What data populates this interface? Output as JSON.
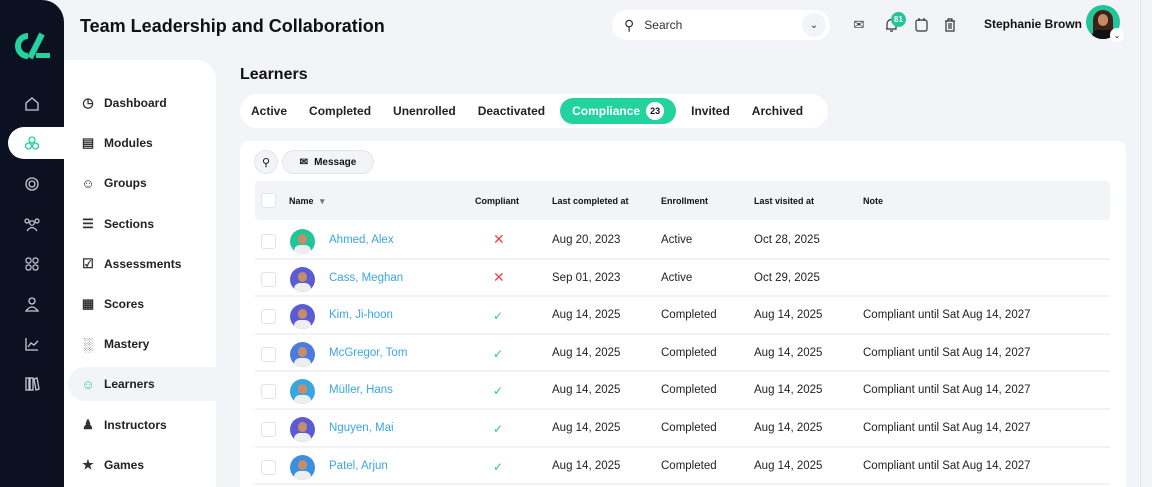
{
  "app": {
    "title": "Team Leadership and Collaboration"
  },
  "header": {
    "search_placeholder": "Search",
    "notification_count": "81",
    "user_name": "Stephanie Brown"
  },
  "rail": {
    "icons": [
      "home-icon",
      "modules-cubes-icon",
      "target-icon",
      "groups-icon",
      "apps-grid-icon",
      "user-icon",
      "chart-icon",
      "library-icon"
    ]
  },
  "sidebar": {
    "items": [
      {
        "label": "Dashboard",
        "icon": "dashboard-icon"
      },
      {
        "label": "Modules",
        "icon": "book-icon"
      },
      {
        "label": "Groups",
        "icon": "groups-icon"
      },
      {
        "label": "Sections",
        "icon": "list-icon"
      },
      {
        "label": "Assessments",
        "icon": "file-check-icon"
      },
      {
        "label": "Scores",
        "icon": "table-icon"
      },
      {
        "label": "Mastery",
        "icon": "bar-chart-icon"
      },
      {
        "label": "Learners",
        "icon": "user-icon",
        "active": true
      },
      {
        "label": "Instructors",
        "icon": "instructor-icon"
      },
      {
        "label": "Games",
        "icon": "trophy-icon"
      }
    ]
  },
  "main": {
    "heading": "Learners",
    "tabs": [
      {
        "label": "Active"
      },
      {
        "label": "Completed"
      },
      {
        "label": "Unenrolled"
      },
      {
        "label": "Deactivated"
      },
      {
        "label": "Compliance",
        "count": "23",
        "active": true
      },
      {
        "label": "Invited"
      },
      {
        "label": "Archived"
      }
    ],
    "toolbar": {
      "message_label": "Message"
    },
    "table": {
      "columns": [
        "Name",
        "Compliant",
        "Last completed at",
        "Enrollment",
        "Last visited at",
        "Note"
      ],
      "rows": [
        {
          "name": "Ahmed, Alex",
          "compliant": false,
          "last_completed": "Aug 20, 2023",
          "enrollment": "Active",
          "last_visited": "Oct 28, 2025",
          "note": "",
          "avatar_color": "#22c59a"
        },
        {
          "name": "Cass, Meghan",
          "compliant": false,
          "last_completed": "Sep 01, 2023",
          "enrollment": "Active",
          "last_visited": "Oct 29, 2025",
          "note": "",
          "avatar_color": "#5b5bd6"
        },
        {
          "name": "Kim, Ji-hoon",
          "compliant": true,
          "last_completed": "Aug 14, 2025",
          "enrollment": "Completed",
          "last_visited": "Aug 14, 2025",
          "note": "Compliant until Sat Aug 14, 2027",
          "avatar_color": "#5b5bd6"
        },
        {
          "name": "McGregor, Tom",
          "compliant": true,
          "last_completed": "Aug 14, 2025",
          "enrollment": "Completed",
          "last_visited": "Aug 14, 2025",
          "note": "Compliant until Sat Aug 14, 2027",
          "avatar_color": "#4a7be0"
        },
        {
          "name": "Müller, Hans",
          "compliant": true,
          "last_completed": "Aug 14, 2025",
          "enrollment": "Completed",
          "last_visited": "Aug 14, 2025",
          "note": "Compliant until Sat Aug 14, 2027",
          "avatar_color": "#3aa6e0"
        },
        {
          "name": "Nguyen, Mai",
          "compliant": true,
          "last_completed": "Aug 14, 2025",
          "enrollment": "Completed",
          "last_visited": "Aug 14, 2025",
          "note": "Compliant until Sat Aug 14, 2027",
          "avatar_color": "#5b5bd6"
        },
        {
          "name": "Patel, Arjun",
          "compliant": true,
          "last_completed": "Aug 14, 2025",
          "enrollment": "Completed",
          "last_visited": "Aug 14, 2025",
          "note": "Compliant until Sat Aug 14, 2027",
          "avatar_color": "#3a8fe0"
        }
      ]
    }
  },
  "colors": {
    "accent": "#22d3a0",
    "rail": "#0b1121",
    "link": "#3aa6e0",
    "fail": "#ef4444"
  }
}
